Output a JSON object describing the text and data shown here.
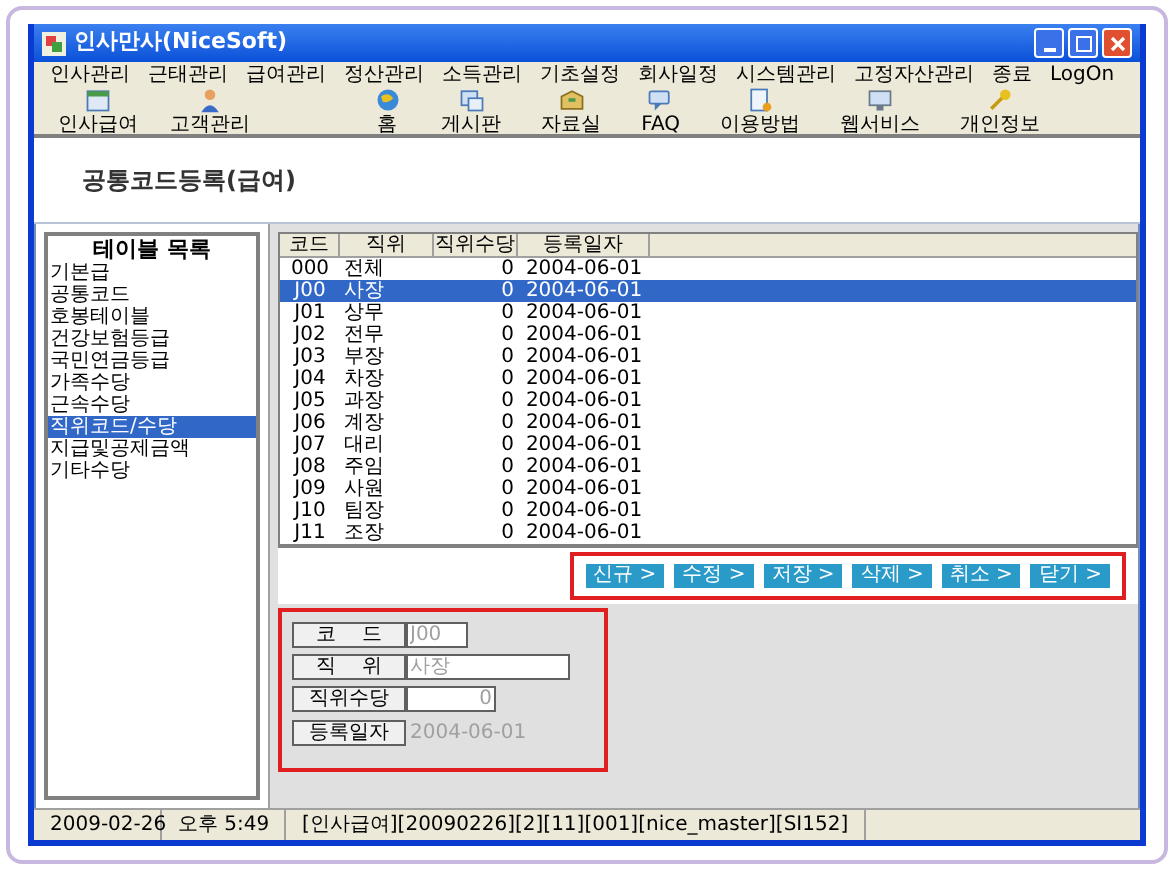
{
  "window": {
    "title": "인사만사(NiceSoft)"
  },
  "menu": [
    "인사관리",
    "근태관리",
    "급여관리",
    "정산관리",
    "소득관리",
    "기초설정",
    "회사일정",
    "시스템관리",
    "고정자산관리",
    "종료",
    "LogOn"
  ],
  "toolbar_left": [
    {
      "label": "인사급여",
      "kind": "calendar"
    },
    {
      "label": "고객관리",
      "kind": "person"
    }
  ],
  "toolbar_right": [
    {
      "label": "홈",
      "kind": "globe"
    },
    {
      "label": "게시판",
      "kind": "board"
    },
    {
      "label": "자료실",
      "kind": "box"
    },
    {
      "label": "FAQ",
      "kind": "chat"
    },
    {
      "label": "이용방법",
      "kind": "doc"
    },
    {
      "label": "웹서비스",
      "kind": "monitor"
    },
    {
      "label": "개인정보",
      "kind": "key"
    }
  ],
  "page_title": "공통코드등록(급여)",
  "table_list": {
    "title": "테이블 목록",
    "items": [
      {
        "label": "기본급",
        "selected": false
      },
      {
        "label": "공통코드",
        "selected": false
      },
      {
        "label": "호봉테이블",
        "selected": false
      },
      {
        "label": "건강보험등급",
        "selected": false
      },
      {
        "label": "국민연금등급",
        "selected": false
      },
      {
        "label": "가족수당",
        "selected": false
      },
      {
        "label": "근속수당",
        "selected": false
      },
      {
        "label": "직위코드/수당",
        "selected": true
      },
      {
        "label": "지급및공제금액",
        "selected": false
      },
      {
        "label": "기타수당",
        "selected": false
      }
    ]
  },
  "table": {
    "columns": [
      "코드",
      "직위",
      "직위수당",
      "등록일자"
    ],
    "rows": [
      {
        "cells": [
          "000",
          "전체",
          "0",
          "2004-06-01"
        ],
        "selected": false
      },
      {
        "cells": [
          "J00",
          "사장",
          "0",
          "2004-06-01"
        ],
        "selected": true
      },
      {
        "cells": [
          "J01",
          "상무",
          "0",
          "2004-06-01"
        ],
        "selected": false
      },
      {
        "cells": [
          "J02",
          "전무",
          "0",
          "2004-06-01"
        ],
        "selected": false
      },
      {
        "cells": [
          "J03",
          "부장",
          "0",
          "2004-06-01"
        ],
        "selected": false
      },
      {
        "cells": [
          "J04",
          "차장",
          "0",
          "2004-06-01"
        ],
        "selected": false
      },
      {
        "cells": [
          "J05",
          "과장",
          "0",
          "2004-06-01"
        ],
        "selected": false
      },
      {
        "cells": [
          "J06",
          "계장",
          "0",
          "2004-06-01"
        ],
        "selected": false
      },
      {
        "cells": [
          "J07",
          "대리",
          "0",
          "2004-06-01"
        ],
        "selected": false
      },
      {
        "cells": [
          "J08",
          "주임",
          "0",
          "2004-06-01"
        ],
        "selected": false
      },
      {
        "cells": [
          "J09",
          "사원",
          "0",
          "2004-06-01"
        ],
        "selected": false
      },
      {
        "cells": [
          "J10",
          "팀장",
          "0",
          "2004-06-01"
        ],
        "selected": false
      },
      {
        "cells": [
          "J11",
          "조장",
          "0",
          "2004-06-01"
        ],
        "selected": false
      }
    ]
  },
  "buttons": [
    "신규 >",
    "수정 >",
    "저장 >",
    "삭제 >",
    "취소 >",
    "닫기 >"
  ],
  "form": [
    {
      "label": "코    드",
      "value": "J00",
      "kind": "short"
    },
    {
      "label": "직    위",
      "value": "사장",
      "kind": "long"
    },
    {
      "label": "직위수당",
      "value": "0",
      "kind": "number"
    },
    {
      "label": "등록일자",
      "value": "2004-06-01",
      "kind": "text"
    }
  ],
  "status_bar": [
    "2009-02-26",
    "오후 5:49",
    "[인사급여][20090226][2][11][001][nice_master][SI152]"
  ]
}
